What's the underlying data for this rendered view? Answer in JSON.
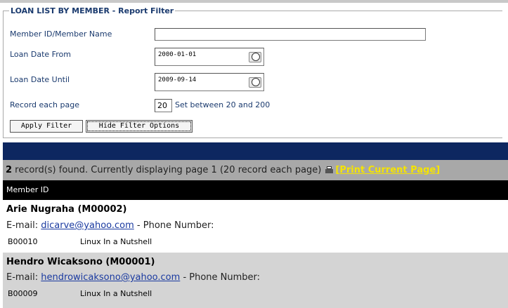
{
  "filter": {
    "legend": "LOAN LIST BY MEMBER - Report Filter",
    "member_label": "Member ID/Member Name",
    "member_value": "",
    "date_from_label": "Loan Date From",
    "date_from_value": "2000-01-01",
    "date_until_label": "Loan Date Until",
    "date_until_value": "2009-09-14",
    "record_label": "Record each page",
    "record_value": "20",
    "record_hint": "Set between 20 and 200",
    "apply_label": "Apply Filter",
    "hide_label": "Hide Filter Options"
  },
  "results": {
    "count": "2",
    "summary": " record(s) found. Currently displaying page 1 (20 record each page)",
    "print_label": "[Print Current Page]",
    "column_header": "Member ID"
  },
  "records": [
    {
      "name": "Arie Nugraha (M00002)",
      "email_prefix": "E-mail: ",
      "email": "dicarve@yahoo.com",
      "phone": " - Phone Number:",
      "item_code": "B00010",
      "item_title": "Linux In a Nutshell"
    },
    {
      "name": "Hendro Wicaksono (M00001)",
      "email_prefix": "E-mail: ",
      "email": "hendrowicaksono@yahoo.com",
      "phone": " - Phone Number:",
      "item_code": "B00009",
      "item_title": "Linux In a Nutshell"
    }
  ],
  "colors": {
    "label": "#1a3a6e",
    "navbar": "#0d2760",
    "infobar": "#a8a8a8",
    "print_link": "#f5e400",
    "odd_row": "#d4d4d4"
  }
}
